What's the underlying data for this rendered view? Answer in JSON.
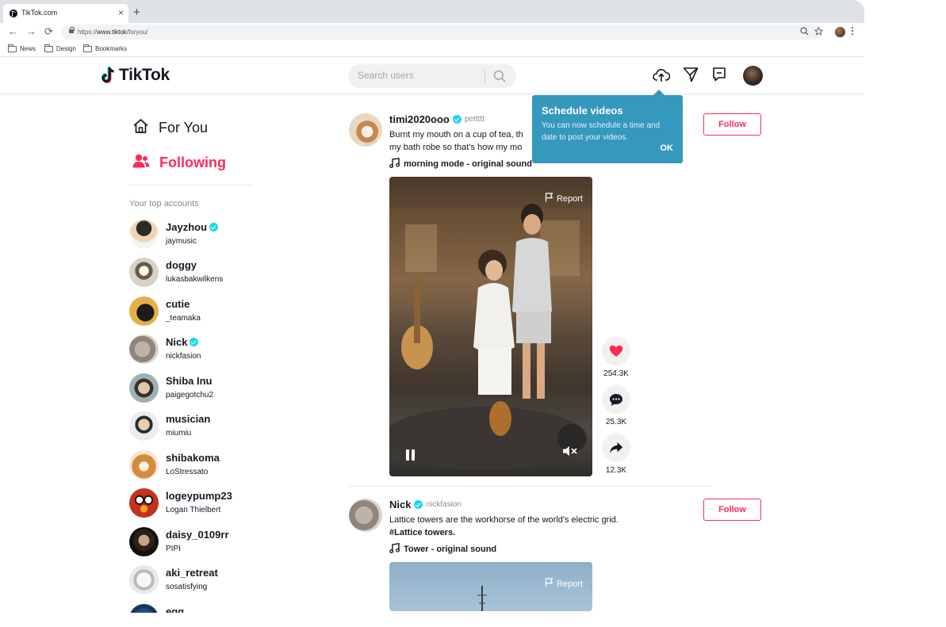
{
  "browser": {
    "tab_title": "TikTok.com",
    "tab_close": "×",
    "new_tab": "+",
    "back": "←",
    "forward": "→",
    "reload": "⟳",
    "url_prefix": "https://",
    "url_host": "www.tiktok",
    "url_path": "/foryou/",
    "bookmarks": [
      "News",
      "Design",
      "Bookmarks"
    ]
  },
  "header": {
    "logo_text": "TikTok",
    "search_placeholder": "Search users",
    "accent_color": "#fe2c55"
  },
  "sidebar": {
    "nav": [
      {
        "label": "For You",
        "icon": "home-icon",
        "active": false
      },
      {
        "label": "Following",
        "icon": "following-icon",
        "active": true
      }
    ],
    "top_accounts_label": "Your top accounts",
    "accounts": [
      {
        "name": "Jayzhou",
        "handle": "jaymusic",
        "verified": true
      },
      {
        "name": "doggy",
        "handle": "lukasbakwilkens",
        "verified": false
      },
      {
        "name": "cutie",
        "handle": "_teamaka",
        "verified": false
      },
      {
        "name": "Nick",
        "handle": "nickfasion",
        "verified": true
      },
      {
        "name": "Shiba Inu",
        "handle": "paigegotchu2",
        "verified": false
      },
      {
        "name": "musician",
        "handle": "miumiu",
        "verified": false
      },
      {
        "name": "shibakoma",
        "handle": "LoStressato",
        "verified": false
      },
      {
        "name": "logeypump23",
        "handle": "Logan Thielbert",
        "verified": false
      },
      {
        "name": "daisy_0109rr",
        "handle": "PIPI",
        "verified": false
      },
      {
        "name": "aki_retreat",
        "handle": "sosatisfying",
        "verified": false
      },
      {
        "name": "egg",
        "handle": "",
        "verified": false
      }
    ]
  },
  "feed": {
    "posts": [
      {
        "username": "timi2020ooo",
        "handle": "pettttt",
        "caption_line1": "Burnt my mouth on a cup of tea, th",
        "caption_line2": "my bath robe so that’s how my mo",
        "sound": "morning mode - original sound",
        "follow_label": "Follow",
        "report_label": "Report",
        "likes": "254.3K",
        "comments": "25.3K",
        "shares": "12.3K"
      },
      {
        "username": "Nick",
        "handle": "nickfasion",
        "caption_line1": "Lattice towers are the workhorse of the world's electric grid.",
        "hashtag": "#Lattice towers.",
        "sound": "Tower - original sound",
        "follow_label": "Follow",
        "report_label": "Report"
      }
    ]
  },
  "tooltip": {
    "title": "Schedule videos",
    "body": "You can now schedule a time and date to post your videos.",
    "ok_label": "OK"
  }
}
